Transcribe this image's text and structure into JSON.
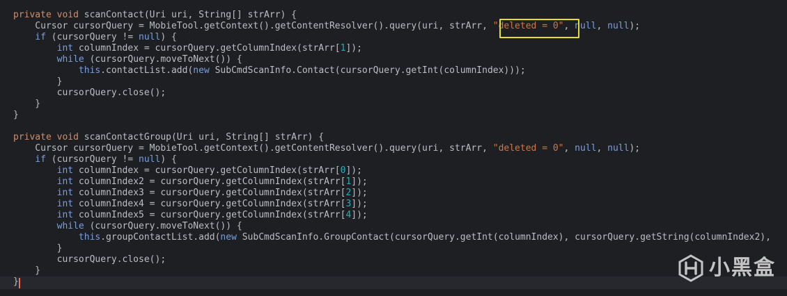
{
  "editor": {
    "lines": [
      [
        {
          "c": "kw",
          "t": "private void "
        },
        {
          "c": "fn",
          "t": "scanContact(Uri uri, "
        },
        {
          "c": "ty",
          "t": "String"
        },
        {
          "c": "fn",
          "t": "[] strArr) {"
        }
      ],
      [
        {
          "c": "fn",
          "t": "    Cursor cursorQuery = MobieTool.getContext().getContentResolver().query(uri, strArr, "
        },
        {
          "c": "str orange",
          "t": "\"deleted = 0\""
        },
        {
          "c": "fn",
          "t": ", "
        },
        {
          "c": "nul",
          "t": "null"
        },
        {
          "c": "fn",
          "t": ", "
        },
        {
          "c": "nul",
          "t": "null"
        },
        {
          "c": "fn",
          "t": ");"
        }
      ],
      [
        {
          "c": "fn",
          "t": "    "
        },
        {
          "c": "kwb",
          "t": "if"
        },
        {
          "c": "fn",
          "t": " (cursorQuery != "
        },
        {
          "c": "nul",
          "t": "null"
        },
        {
          "c": "fn",
          "t": ") {"
        }
      ],
      [
        {
          "c": "fn",
          "t": "        "
        },
        {
          "c": "kwb",
          "t": "int"
        },
        {
          "c": "fn",
          "t": " columnIndex = cursorQuery.getColumnIndex(strArr["
        },
        {
          "c": "num",
          "t": "1"
        },
        {
          "c": "fn",
          "t": "]);"
        }
      ],
      [
        {
          "c": "fn",
          "t": "        "
        },
        {
          "c": "kwb",
          "t": "while"
        },
        {
          "c": "fn",
          "t": " (cursorQuery.moveToNext()) {"
        }
      ],
      [
        {
          "c": "fn",
          "t": "            "
        },
        {
          "c": "kwb",
          "t": "this"
        },
        {
          "c": "fn",
          "t": ".contactList.add("
        },
        {
          "c": "kwb",
          "t": "new"
        },
        {
          "c": "fn",
          "t": " SubCmdScanInfo.Contact(cursorQuery.getInt(columnIndex)));"
        }
      ],
      [
        {
          "c": "fn",
          "t": "        }"
        }
      ],
      [
        {
          "c": "fn",
          "t": "        cursorQuery.close();"
        }
      ],
      [
        {
          "c": "fn",
          "t": "    }"
        }
      ],
      [
        {
          "c": "fn",
          "t": "}"
        }
      ],
      [
        {
          "c": "fn",
          "t": ""
        }
      ],
      [
        {
          "c": "kw",
          "t": "private void "
        },
        {
          "c": "fn",
          "t": "scanContactGroup(Uri uri, "
        },
        {
          "c": "ty",
          "t": "String"
        },
        {
          "c": "fn",
          "t": "[] strArr) {"
        }
      ],
      [
        {
          "c": "fn",
          "t": "    Cursor cursorQuery = MobieTool.getContext().getContentResolver().query(uri, strArr, "
        },
        {
          "c": "str orange",
          "t": "\"deleted = 0\""
        },
        {
          "c": "fn",
          "t": ", "
        },
        {
          "c": "nul",
          "t": "null"
        },
        {
          "c": "fn",
          "t": ", "
        },
        {
          "c": "nul",
          "t": "null"
        },
        {
          "c": "fn",
          "t": ");"
        }
      ],
      [
        {
          "c": "fn",
          "t": "    "
        },
        {
          "c": "kwb",
          "t": "if"
        },
        {
          "c": "fn",
          "t": " (cursorQuery != "
        },
        {
          "c": "nul",
          "t": "null"
        },
        {
          "c": "fn",
          "t": ") {"
        }
      ],
      [
        {
          "c": "fn",
          "t": "        "
        },
        {
          "c": "kwb",
          "t": "int"
        },
        {
          "c": "fn",
          "t": " columnIndex = cursorQuery.getColumnIndex(strArr["
        },
        {
          "c": "num",
          "t": "0"
        },
        {
          "c": "fn",
          "t": "]);"
        }
      ],
      [
        {
          "c": "fn",
          "t": "        "
        },
        {
          "c": "kwb",
          "t": "int"
        },
        {
          "c": "fn",
          "t": " columnIndex2 = cursorQuery.getColumnIndex(strArr["
        },
        {
          "c": "num",
          "t": "1"
        },
        {
          "c": "fn",
          "t": "]);"
        }
      ],
      [
        {
          "c": "fn",
          "t": "        "
        },
        {
          "c": "kwb",
          "t": "int"
        },
        {
          "c": "fn",
          "t": " columnIndex3 = cursorQuery.getColumnIndex(strArr["
        },
        {
          "c": "num",
          "t": "2"
        },
        {
          "c": "fn",
          "t": "]);"
        }
      ],
      [
        {
          "c": "fn",
          "t": "        "
        },
        {
          "c": "kwb",
          "t": "int"
        },
        {
          "c": "fn",
          "t": " columnIndex4 = cursorQuery.getColumnIndex(strArr["
        },
        {
          "c": "num",
          "t": "3"
        },
        {
          "c": "fn",
          "t": "]);"
        }
      ],
      [
        {
          "c": "fn",
          "t": "        "
        },
        {
          "c": "kwb",
          "t": "int"
        },
        {
          "c": "fn",
          "t": " columnIndex5 = cursorQuery.getColumnIndex(strArr["
        },
        {
          "c": "num",
          "t": "4"
        },
        {
          "c": "fn",
          "t": "]);"
        }
      ],
      [
        {
          "c": "fn",
          "t": "        "
        },
        {
          "c": "kwb",
          "t": "while"
        },
        {
          "c": "fn",
          "t": " (cursorQuery.moveToNext()) {"
        }
      ],
      [
        {
          "c": "fn",
          "t": "            "
        },
        {
          "c": "kwb",
          "t": "this"
        },
        {
          "c": "fn",
          "t": ".groupContactList.add("
        },
        {
          "c": "kwb",
          "t": "new"
        },
        {
          "c": "fn",
          "t": " SubCmdScanInfo.GroupContact(cursorQuery.getInt(columnIndex), cursorQuery.getString(columnIndex2),"
        }
      ],
      [
        {
          "c": "fn",
          "t": "        }"
        }
      ],
      [
        {
          "c": "fn",
          "t": "        cursorQuery.close();"
        }
      ],
      [
        {
          "c": "fn",
          "t": "    }"
        }
      ],
      [
        {
          "c": "fn",
          "t": "}"
        }
      ]
    ]
  },
  "colors": {
    "background": "#1e1f22",
    "highlight_box": "#e6e022",
    "caret": "#f26b5e"
  },
  "watermark": {
    "text": "小黑盒",
    "icon": "heybox-logo-icon"
  }
}
